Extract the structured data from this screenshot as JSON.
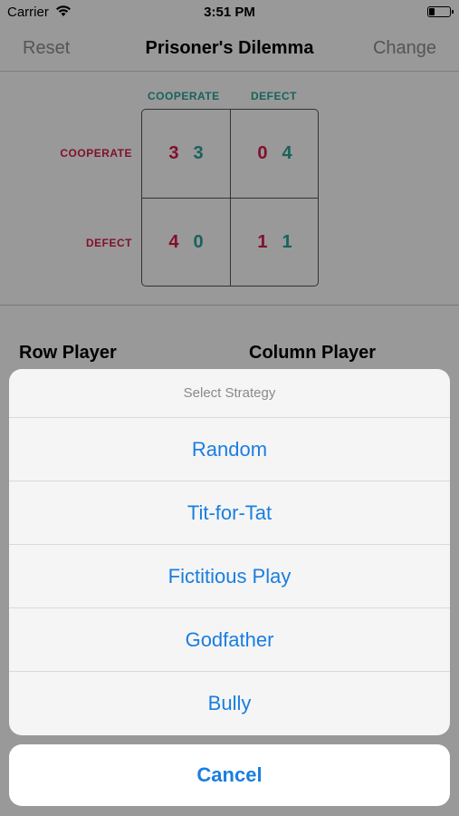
{
  "status_bar": {
    "carrier": "Carrier",
    "time": "3:51 PM"
  },
  "nav": {
    "left": "Reset",
    "title": "Prisoner's Dilemma",
    "right": "Change"
  },
  "matrix": {
    "col_headers": [
      "COOPERATE",
      "DEFECT"
    ],
    "row_headers": [
      "COOPERATE",
      "DEFECT"
    ],
    "cells": [
      [
        {
          "row": "3",
          "col": "3"
        },
        {
          "row": "0",
          "col": "4"
        }
      ],
      [
        {
          "row": "4",
          "col": "0"
        },
        {
          "row": "1",
          "col": "1"
        }
      ]
    ],
    "colors": {
      "row_player": "#d81b4a",
      "column_player": "#2aa39b"
    }
  },
  "players": {
    "row": "Row Player",
    "column": "Column Player"
  },
  "action_sheet": {
    "title": "Select Strategy",
    "options": [
      "Random",
      "Tit-for-Tat",
      "Fictitious Play",
      "Godfather",
      "Bully"
    ],
    "cancel": "Cancel",
    "accent": "#1a7ee0"
  }
}
